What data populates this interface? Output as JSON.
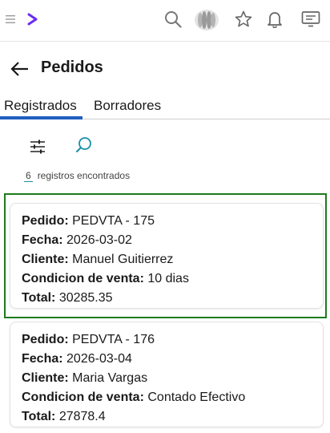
{
  "toolbar": {
    "icons": [
      "menu-icon",
      "app-logo-icon",
      "search-icon",
      "brand-icon",
      "star-icon",
      "bell-icon",
      "screen-icon"
    ]
  },
  "header": {
    "title": "Pedidos"
  },
  "tabs": [
    {
      "label": "Registrados",
      "active": true
    },
    {
      "label": "Borradores",
      "active": false
    }
  ],
  "results": {
    "count": "6",
    "label": "registros encontrados"
  },
  "labels": {
    "order": "Pedido:",
    "date": "Fecha:",
    "client": "Cliente:",
    "condition": "Condicion de venta:",
    "total": "Total:"
  },
  "orders": [
    {
      "order": "PEDVTA - 175",
      "date": "2026-03-02",
      "client": "Manuel Guitierrez",
      "condition": "10 dias",
      "total": "30285.35"
    },
    {
      "order": "PEDVTA - 176",
      "date": "2026-03-04",
      "client": "Maria Vargas",
      "condition": "Contado Efectivo",
      "total": "27878.4"
    }
  ],
  "colors": {
    "accent": "#1f5fbf",
    "logo": "#6b2cf0",
    "selection": "#1e7a1e",
    "search_blue": "#1a8fa8"
  }
}
